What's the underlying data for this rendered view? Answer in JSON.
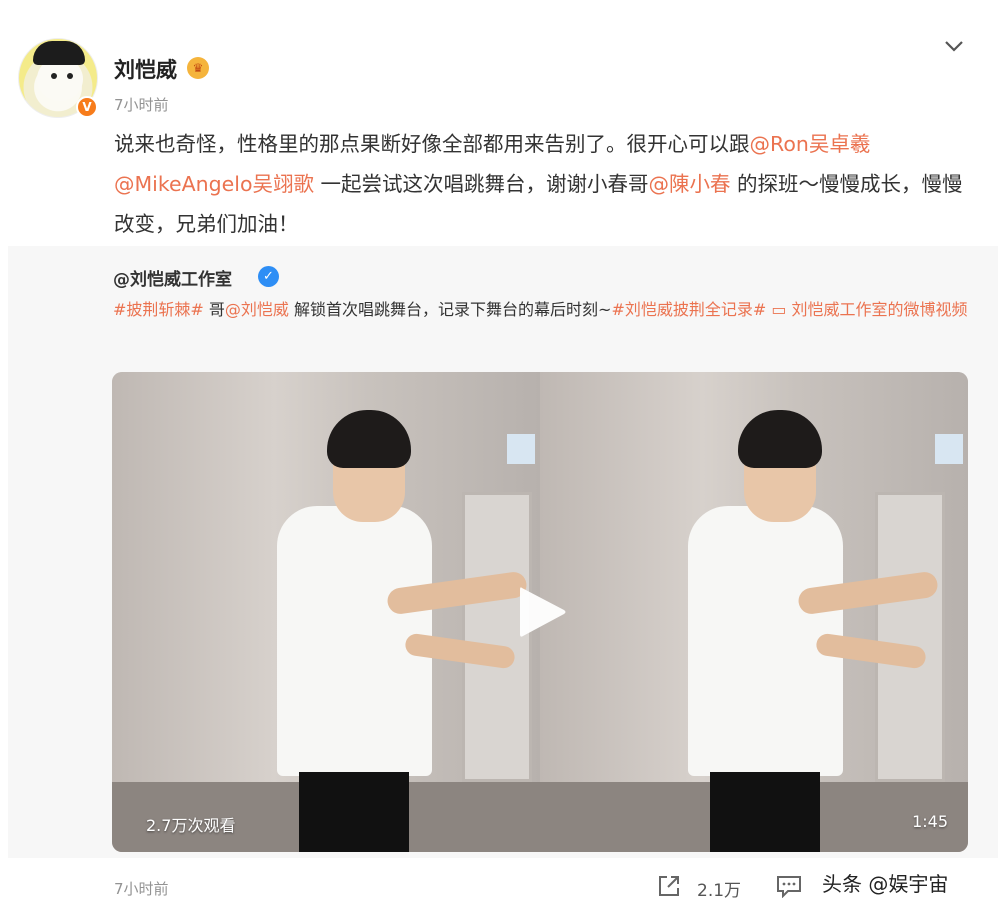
{
  "user": {
    "name": "刘恺威",
    "time": "7小时前",
    "badge_icon": "verified-orange-icon",
    "vip_icon": "crown-icon"
  },
  "post": {
    "text_1": "说来也奇怪，性格里的那点果断好像全部都用来告别了。很开心可以跟",
    "mention_1": "@Ron吴卓羲",
    "mention_2": "@MikeAngelo吴翊歌",
    "text_2": " 一起尝试这次唱跳舞台，谢谢小春哥",
    "mention_3": "@陳小春",
    "text_3": " 的探班～慢慢成长，慢慢改变，兄弟们加油！"
  },
  "repost": {
    "author": "@刘恺威工作室",
    "tag_1": "#披荆斩棘#",
    "text_1": " 哥",
    "mention_1": "@刘恺威",
    "text_2": " 解锁首次唱跳舞台，记录下舞台的幕后时刻~",
    "tag_2": "#刘恺威披荆全记录#",
    "video_link": " ▭ 刘恺威工作室的微博视频",
    "video": {
      "views": "2.7万次观看",
      "duration": "1:45"
    }
  },
  "footer": {
    "time": "7小时前",
    "share_count": "2.1万",
    "watermark": "头条 @娱宇宙"
  },
  "colors": {
    "accent": "#eb7350",
    "verified_blue": "#2e8ef5",
    "muted": "#939393"
  }
}
